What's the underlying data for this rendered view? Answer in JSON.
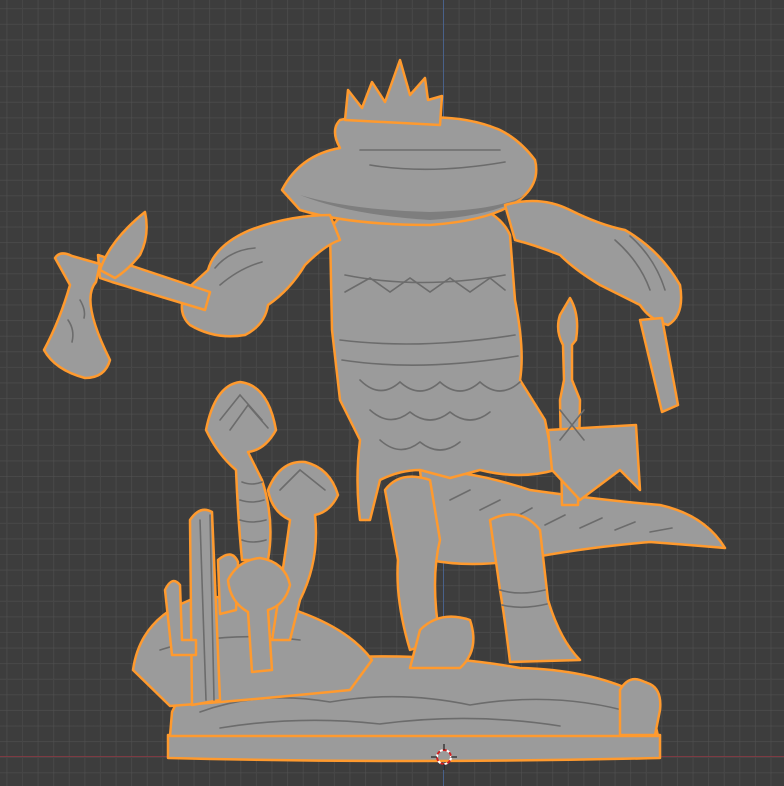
{
  "viewport": {
    "background": "#3d3d3d",
    "grid_color": "#464646",
    "selection_outline_color": "#ff9a2e",
    "model_color": "#9b9b9b",
    "x_axis_color": "#8a3a42",
    "y_axis_color": "#4a6aa0"
  },
  "scene": {
    "object": "lizardfolk-warrior-miniature",
    "selected": true,
    "cursor": "3d-cursor-icon"
  }
}
